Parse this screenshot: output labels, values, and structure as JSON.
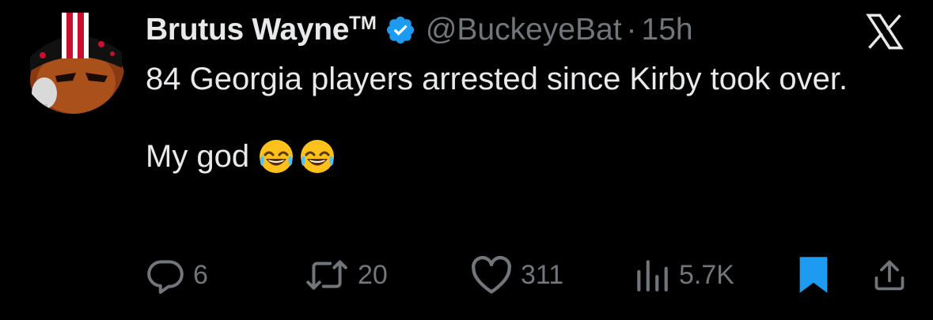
{
  "tweet": {
    "display_name": "Brutus Wayne",
    "trademark": "TM",
    "verified_icon": "verified-badge-icon",
    "handle": "@BuckeyeBat",
    "separator": "·",
    "time": "15h",
    "text_line1": "84 Georgia players arrested since Kirby took over.",
    "text_line2": "My god",
    "emojis": [
      "face-with-tears-of-joy",
      "face-with-tears-of-joy"
    ]
  },
  "actions": {
    "replies": "6",
    "reposts": "20",
    "likes": "311",
    "views": "5.7K"
  },
  "icons": {
    "reply": "reply-icon",
    "repost": "repost-icon",
    "like": "heart-icon",
    "views": "views-icon",
    "bookmark": "bookmark-icon",
    "share": "share-icon",
    "brand": "x-logo-icon"
  },
  "colors": {
    "background": "#000000",
    "text": "#e7e9ea",
    "secondary": "#71767b",
    "accent": "#1d9bf0"
  }
}
